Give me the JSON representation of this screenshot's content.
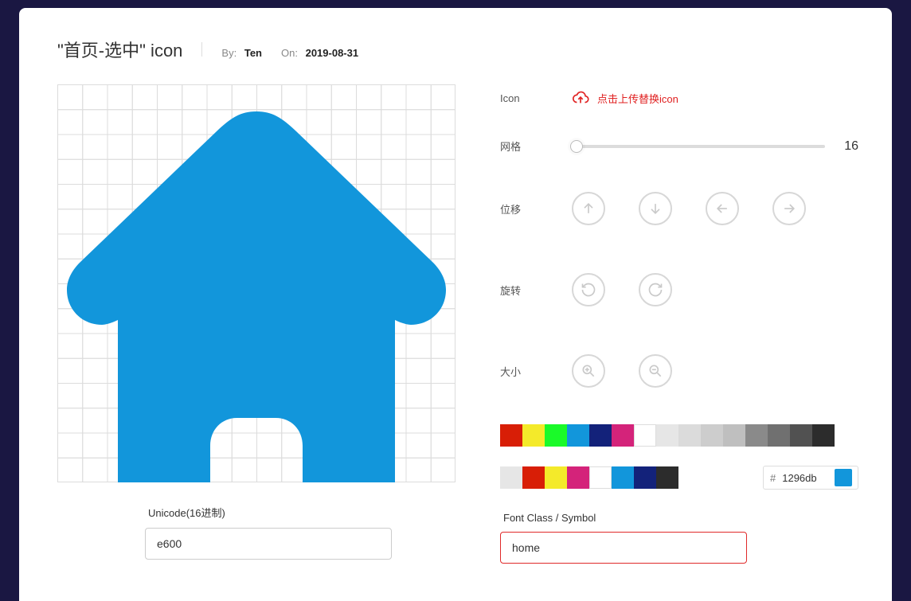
{
  "header": {
    "title": "\"首页-选中\" icon",
    "by_label": "By:",
    "by_value": "Ten",
    "on_label": "On:",
    "on_value": "2019-08-31"
  },
  "icon_color": "#1296db",
  "controls": {
    "icon_label": "Icon",
    "upload_text": "点击上传替换icon",
    "grid_label": "网格",
    "grid_value": "16",
    "grid_slider_percent": 2,
    "shift_label": "位移",
    "rotate_label": "旋转",
    "size_label": "大小"
  },
  "palette_preset": [
    "#d81e06",
    "#f4ea2a",
    "#1afa29",
    "#1296db",
    "#13227a",
    "#d4237a",
    "#ffffff",
    "#e6e6e6",
    "#dbdbdb",
    "#cdcdcd",
    "#bfbfbf",
    "#8a8a8a",
    "#707070",
    "#515151",
    "#2c2c2c"
  ],
  "palette_recent": [
    "#e6e6e6",
    "#d81e06",
    "#f4ea2a",
    "#d4237a",
    "#ffffff",
    "#1296db",
    "#13227a",
    "#2c2c2c"
  ],
  "color_input": {
    "prefix": "#",
    "value": "1296db",
    "preview": "#1296db"
  },
  "fields": {
    "unicode_label": "Unicode(16进制)",
    "unicode_value": "e600",
    "fontclass_label": "Font Class / Symbol",
    "fontclass_value": "home"
  }
}
